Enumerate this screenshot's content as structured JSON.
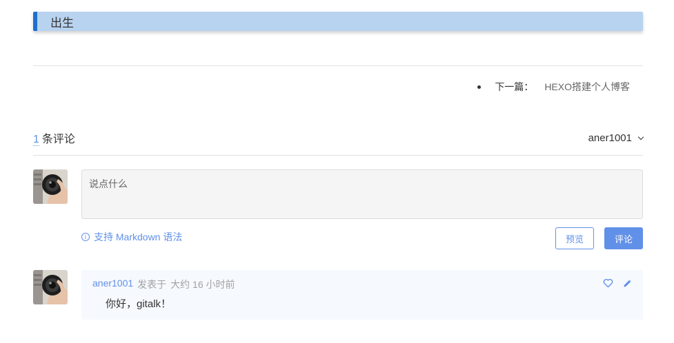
{
  "section": {
    "heading": "出生"
  },
  "post_nav": {
    "next_label": "下一篇：",
    "next_title": "HEXO搭建个人博客"
  },
  "comments": {
    "count": "1",
    "count_suffix": "条评论",
    "current_user": "aner1001",
    "input_placeholder": "说点什么",
    "markdown_tip": "支持 Markdown 语法",
    "preview_button": "预览",
    "submit_button": "评论",
    "items": [
      {
        "author": "aner1001",
        "action": "发表于",
        "time": "大约 16 小时前",
        "body": "你好，gitalk！"
      }
    ]
  },
  "colors": {
    "accent": "#6190e8",
    "heading_bg": "#b8d3f0",
    "heading_border": "#1e6fd0",
    "comment_bg": "#f6f9fe"
  },
  "icons": {
    "info": "info-icon",
    "chevron": "chevron-down-icon",
    "like": "heart-icon",
    "edit": "pencil-icon"
  }
}
